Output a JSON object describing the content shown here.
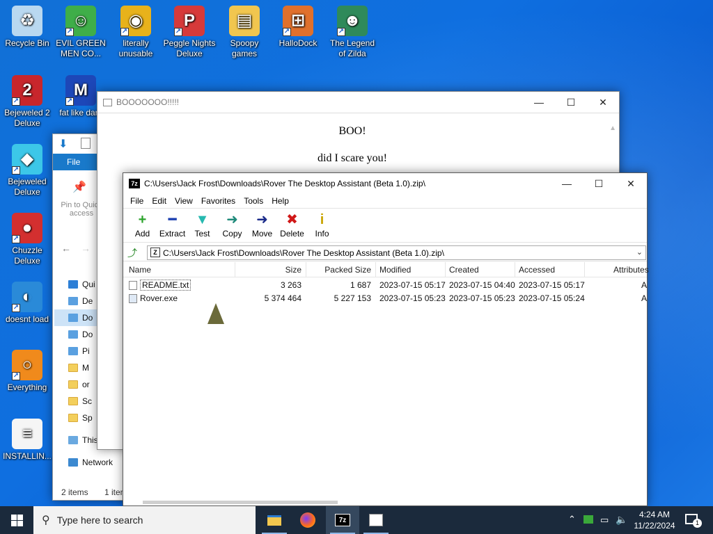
{
  "desktop": {
    "icons": [
      {
        "label": "Recycle Bin",
        "glyph": "♻",
        "icon": "recycle-bin-icon",
        "color": "#b9d8f0",
        "shortcut": false
      },
      {
        "label": "EVIL GREEN MEN CO...",
        "glyph": "☺",
        "icon": "green-men-icon",
        "color": "#3fae49",
        "shortcut": true
      },
      {
        "label": "literally unusable",
        "glyph": "◉",
        "icon": "chrome-icon",
        "color": "#e8b21b",
        "shortcut": true
      },
      {
        "label": "Peggle Nights Deluxe",
        "glyph": "P",
        "icon": "peggle-icon",
        "color": "#d63a3a",
        "shortcut": true
      },
      {
        "label": "Spoopy games",
        "glyph": "▤",
        "icon": "folder-icon",
        "color": "#f1c64f",
        "shortcut": false
      },
      {
        "label": "HalloDock",
        "glyph": "⊞",
        "icon": "shield-icon",
        "color": "#e0702c",
        "shortcut": true
      },
      {
        "label": "The Legend of Zilda",
        "glyph": "☻",
        "icon": "zilda-icon",
        "color": "#2f8a5a",
        "shortcut": true
      },
      {
        "label": "Bejeweled 2 Deluxe",
        "glyph": "2",
        "icon": "bejeweled2-icon",
        "color": "#c8262c",
        "shortcut": true
      },
      {
        "label": "fat like dark",
        "glyph": "M",
        "icon": "mpl-icon",
        "color": "#1d47b8",
        "shortcut": true
      },
      {
        "label": "Bejeweled Deluxe",
        "glyph": "◆",
        "icon": "bejeweled-icon",
        "color": "#3cc7e8",
        "shortcut": true
      },
      {
        "label": "Chuzzle Deluxe",
        "glyph": "●",
        "icon": "chuzzle-icon",
        "color": "#d32f2f",
        "shortcut": true
      },
      {
        "label": "doesnt load",
        "glyph": "◐",
        "icon": "thunderbird-icon",
        "color": "#2a8ad8",
        "shortcut": true
      },
      {
        "label": "Everything",
        "glyph": "○",
        "icon": "everything-icon",
        "color": "#f08a1c",
        "shortcut": true
      },
      {
        "label": "INSTALLIN...",
        "glyph": "≡",
        "icon": "text-file-icon",
        "color": "#f5f5f5",
        "shortcut": false
      }
    ]
  },
  "explorer": {
    "file_tab": "File",
    "pin_label": "Pin to Quick access",
    "nav": [
      "Qui",
      "De",
      "Do",
      "Do",
      "Pi",
      "M",
      "or",
      "Sc",
      "Sp",
      "This",
      "Network"
    ],
    "status_items": "2 items",
    "status_selected": "1 item"
  },
  "boo": {
    "title": "BOOOOOOO!!!!!",
    "line1": "BOO!",
    "line2": "did I scare you!"
  },
  "sevenzip": {
    "title": "C:\\Users\\Jack Frost\\Downloads\\Rover The Desktop Assistant (Beta 1.0).zip\\",
    "menu": [
      "File",
      "Edit",
      "View",
      "Favorites",
      "Tools",
      "Help"
    ],
    "tools": [
      {
        "label": "Add",
        "glyph": "+",
        "color": "#2aa22a"
      },
      {
        "label": "Extract",
        "glyph": "━",
        "color": "#1b3fb0"
      },
      {
        "label": "Test",
        "glyph": "▼",
        "color": "#27b9b0"
      },
      {
        "label": "Copy",
        "glyph": "➜",
        "color": "#1f8a7a"
      },
      {
        "label": "Move",
        "glyph": "➜",
        "color": "#1b2b8a"
      },
      {
        "label": "Delete",
        "glyph": "✖",
        "color": "#d01818"
      },
      {
        "label": "Info",
        "glyph": "i",
        "color": "#c9a400"
      }
    ],
    "address": "C:\\Users\\Jack Frost\\Downloads\\Rover The Desktop Assistant (Beta 1.0).zip\\",
    "columns": [
      "Name",
      "Size",
      "Packed Size",
      "Modified",
      "Created",
      "Accessed",
      "Attributes"
    ],
    "files": [
      {
        "name": "README.txt",
        "size": "3 263",
        "packed": "1 687",
        "modified": "2023-07-15 05:17",
        "created": "2023-07-15 04:40",
        "accessed": "2023-07-15 05:17",
        "attr": "A"
      },
      {
        "name": "Rover.exe",
        "size": "5 374 464",
        "packed": "5 227 153",
        "modified": "2023-07-15 05:23",
        "created": "2023-07-15 05:23",
        "accessed": "2023-07-15 05:24",
        "attr": "A"
      }
    ]
  },
  "taskbar": {
    "search_placeholder": "Type here to search",
    "time": "4:24 AM",
    "date": "11/22/2024",
    "notif_count": "1"
  }
}
